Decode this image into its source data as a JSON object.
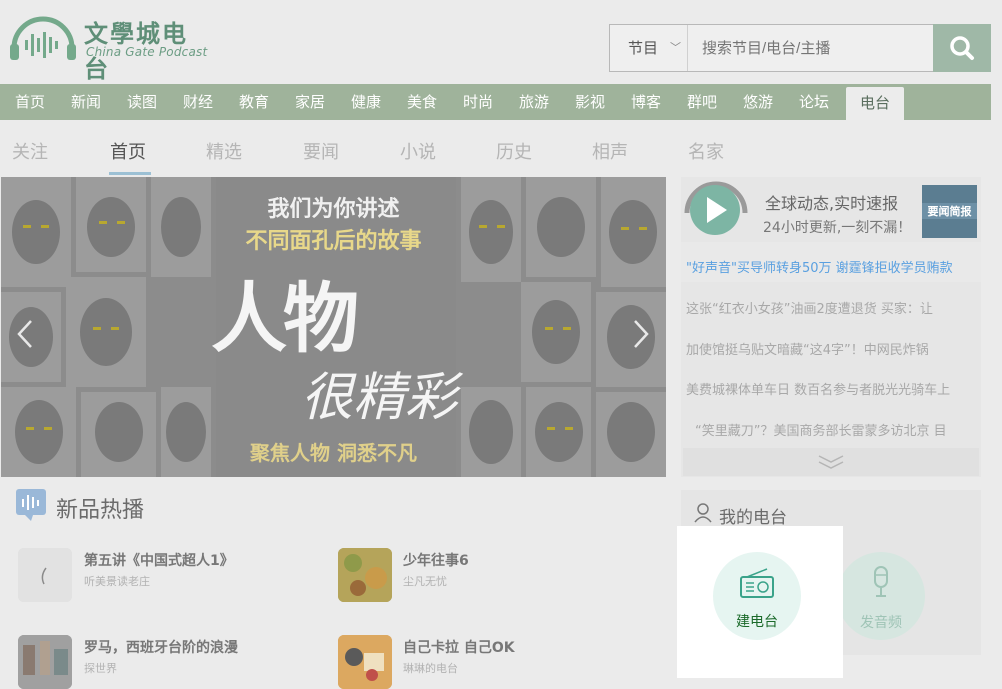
{
  "logo": {
    "title": "文學城电台",
    "subtitle": "China Gate Podcast"
  },
  "search": {
    "category": "节目",
    "placeholder": "搜索节目/电台/主播"
  },
  "nav": {
    "items": [
      "首页",
      "新闻",
      "读图",
      "财经",
      "教育",
      "家居",
      "健康",
      "美食",
      "时尚",
      "旅游",
      "影视",
      "博客",
      "群吧",
      "悠游",
      "论坛",
      "电台"
    ],
    "active": "电台"
  },
  "subtabs": {
    "items": [
      "关注",
      "首页",
      "精选",
      "要闻",
      "小说",
      "历史",
      "相声",
      "名家"
    ],
    "active": "首页"
  },
  "banner": {
    "line1": "我们为你讲述",
    "line2": "不同面孔后的故事",
    "big1": "人物",
    "big2": "很精彩",
    "bottom": "聚焦人物 洞悉不凡"
  },
  "news": {
    "promo_title": "全球动态,实时速报",
    "promo_sub": "24小时更新,一刻不漏！",
    "promo_badge": "要闻简报",
    "headlines": [
      "\"好声音\"买导师转身50万 谢霆锋拒收学员贿款",
      "这张“红衣小女孩”油画2度遭退货 买家：让",
      "加使馆挺乌贴文暗藏“这4字”！中网民炸锅",
      "美费城裸体单车日 数百名参与者脱光光骑车上",
      "“笑里藏刀”？美国商务部长雷蒙多访北京 目"
    ]
  },
  "new_releases": {
    "title": "新品热播",
    "items": [
      {
        "title": "第五讲《中国式超人1》",
        "author": "听美景读老庄"
      },
      {
        "title": "少年往事6",
        "author": "尘凡无忧"
      },
      {
        "title": "罗马，西班牙台阶的浪漫",
        "author": "探世界"
      },
      {
        "title": "自己卡拉 自己OK",
        "author": "琳琳的电台"
      }
    ]
  },
  "my_station": {
    "title": "我的电台",
    "create_label": "建电台",
    "upload_label": "发音频"
  },
  "colors": {
    "accent_green": "#9fb39b",
    "highlight_blue": "#5aa0e0",
    "teal": "#7ccfc0"
  }
}
